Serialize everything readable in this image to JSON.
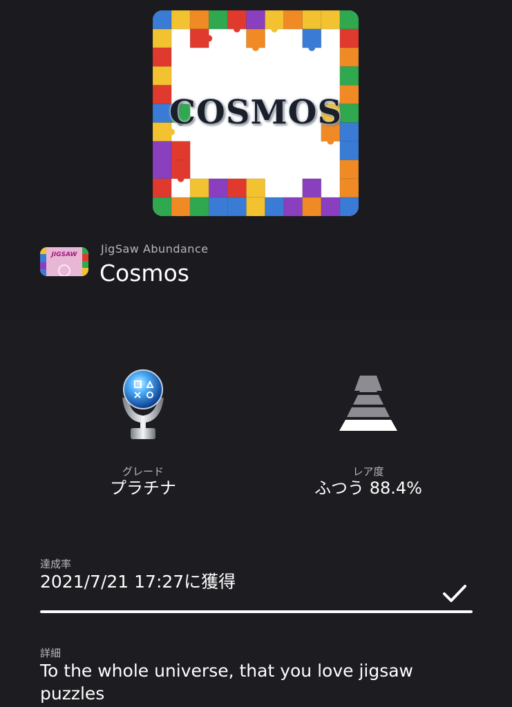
{
  "trophy_art": {
    "title_text": "COSMOS",
    "icon": "jigsaw-puzzle-frame"
  },
  "game": {
    "thumbnail_text": "JIGSAW",
    "name": "JigSaw Abundance",
    "trophy_name": "Cosmos"
  },
  "grade": {
    "icon": "platinum-trophy-icon",
    "label": "グレード",
    "value": "プラチナ"
  },
  "rarity": {
    "icon": "rarity-pyramid-icon",
    "label": "レア度",
    "value": "ふつう 88.4%"
  },
  "achievement": {
    "label": "達成率",
    "value": "2021/7/21  17:27に獲得",
    "progress_percent": 100,
    "status_icon": "checkmark-icon"
  },
  "details": {
    "label": "詳細",
    "text": "To the whole universe, that you love jigsaw puzzles"
  },
  "colors": {
    "background": "#1c1c21",
    "header_background": "#1a1a1f",
    "text_primary": "#ffffff",
    "text_secondary": "#b8b8be"
  }
}
